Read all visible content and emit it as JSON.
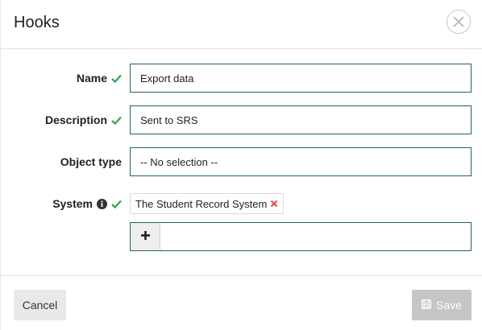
{
  "dialog": {
    "title": "Hooks"
  },
  "form": {
    "name": {
      "label": "Name",
      "value": "Export data",
      "valid": true
    },
    "description": {
      "label": "Description",
      "value": "Sent to SRS",
      "valid": true
    },
    "object_type": {
      "label": "Object type",
      "value": "-- No selection --"
    },
    "system": {
      "label": "System",
      "valid": true,
      "has_info": true,
      "selected": [
        {
          "label": "The Student Record System"
        }
      ],
      "add_button": "+"
    }
  },
  "footer": {
    "cancel_label": "Cancel",
    "save_label": "Save",
    "save_disabled": true
  },
  "colors": {
    "valid_check": "#3aa655",
    "field_border": "#1f6b3e",
    "remove_x": "#d9534f",
    "save_disabled_bg": "#c6c6c6",
    "cancel_bg": "#e9e9e9"
  },
  "icons": {
    "close": "close-circle-icon",
    "check": "check-icon",
    "info": "info-circle-icon",
    "remove": "remove-x-icon",
    "add": "plus-icon",
    "save": "save-disk-icon"
  }
}
